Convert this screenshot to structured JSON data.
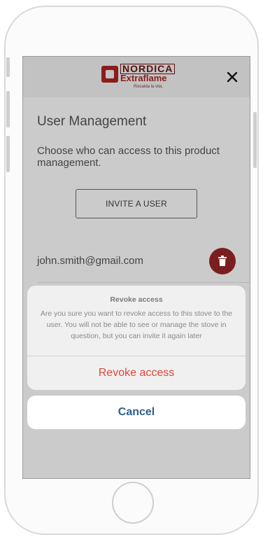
{
  "brand": {
    "logo_top": "NORDICA",
    "logo_bottom": "Extraflame",
    "tagline": "Riscalda la vita.",
    "colors": {
      "primary": "#8b1c1c",
      "dark": "#5a0f0f"
    }
  },
  "page": {
    "title": "User Management",
    "description": "Choose who can access to this product management.",
    "invite_button": "INVITE A USER"
  },
  "users": [
    {
      "email": "john.smith@gmail.com"
    }
  ],
  "dialog": {
    "title": "Revoke access",
    "message": "Are you sure you want to revoke access to this stove to the user. You will not be able to see or manage the stove in question, but you can invite it again later",
    "action_label": "Revoke access",
    "cancel_label": "Cancel",
    "action_color": "#e0453a",
    "cancel_color": "#2f5f8f"
  },
  "icons": {
    "close": "close-icon",
    "delete": "trash-icon"
  }
}
